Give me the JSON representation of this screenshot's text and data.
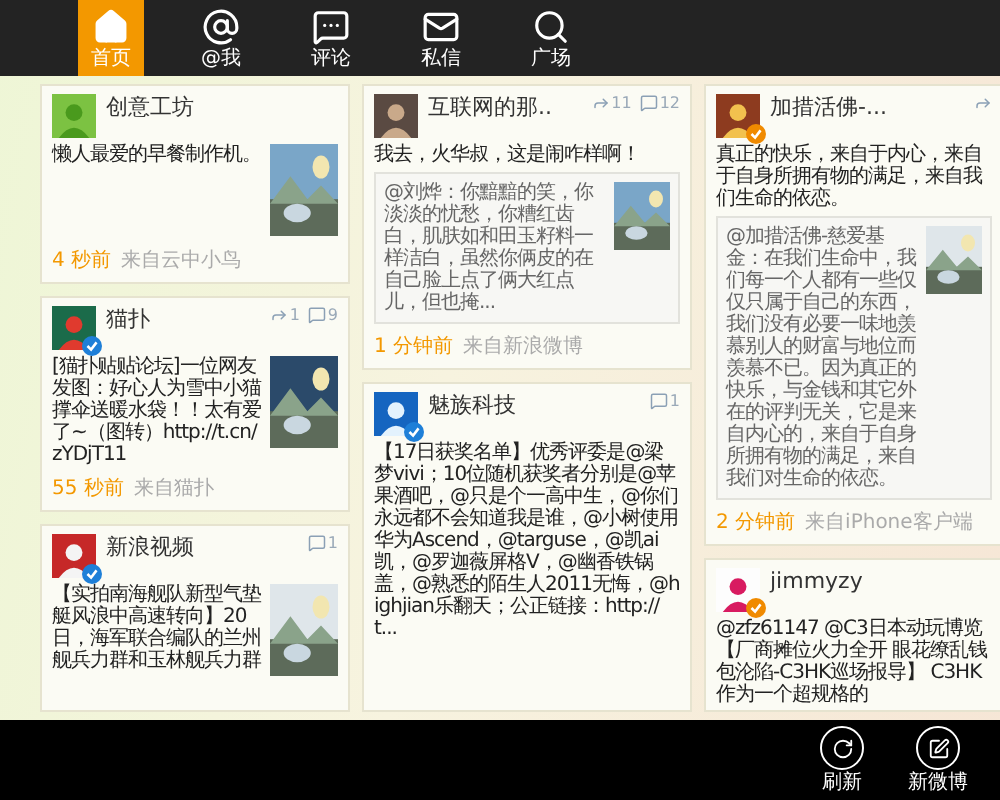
{
  "nav": {
    "tabs": [
      {
        "kind": "home",
        "label": "首页",
        "selected": true
      },
      {
        "kind": "at",
        "label": "@我",
        "selected": false
      },
      {
        "kind": "comment",
        "label": "评论",
        "selected": false
      },
      {
        "kind": "mail",
        "label": "私信",
        "selected": false
      },
      {
        "kind": "search",
        "label": "广场",
        "selected": false
      }
    ]
  },
  "columns": [
    {
      "posts": [
        {
          "name": "创意工坊",
          "verified": false,
          "text": "懒人最爱的早餐制作机。",
          "image": {
            "kind": "picture"
          },
          "time": "4 秒前",
          "source": "来自云中小鸟"
        },
        {
          "name": "猫扑",
          "verified": true,
          "color": "#1e7fd8",
          "counts": [
            {
              "kind": "repost",
              "count": "1"
            },
            {
              "kind": "comment",
              "count": "9"
            }
          ],
          "text": "[猫扑贴贴论坛]一位网友发图：好心人为雪中小猫撑伞送暖水袋！！太有爱了~（图转）http://t.cn/zYDjT11",
          "image": {
            "kind": "picture"
          },
          "time": "55 秒前",
          "source": "来自猫扑"
        },
        {
          "name": "新浪视频",
          "verified": true,
          "color": "#1e7fd8",
          "counts": [
            {
              "kind": "comment",
              "count": "1"
            }
          ],
          "text": "【实拍南海舰队新型气垫艇风浪中高速转向】20日，海军联合编队的兰州舰兵力群和玉林舰兵力群",
          "image": {
            "kind": "picture"
          }
        }
      ]
    },
    {
      "posts": [
        {
          "name": "互联网的那..",
          "verified": false,
          "counts": [
            {
              "kind": "repost",
              "count": "11"
            },
            {
              "kind": "comment",
              "count": "12"
            }
          ],
          "text": "我去，火华叔，这是闹咋样啊！",
          "quote": {
            "text": "@刘烨：你黯黯的笑，你淡淡的忧愁，你糟红齿白，肌肤如和田玉籽料一样洁白，虽然你俩皮的在自己脸上点了俩大红点儿，但也掩...",
            "image": {
              "kind": "picture"
            }
          },
          "time": "1 分钟前",
          "source": "来自新浪微博"
        },
        {
          "name": "魅族科技",
          "verified": true,
          "color": "#1e7fd8",
          "counts": [
            {
              "kind": "comment",
              "count": "1"
            }
          ],
          "text": "【17日获奖名单】优秀评委是@梁梦vivi；10位随机获奖者分别是@苹果酒吧，@只是个一高中生，@你们永远都不会知道我是谁，@小树使用华为Ascend，@targuse，@凯ai凯，@罗迦薇屏格V，@幽香铁锅盖，@熟悉的陌生人2011无悔，@highjian乐翻天；公正链接：http://t..."
        }
      ]
    },
    {
      "posts": [
        {
          "name": "加措活佛-...",
          "verified": true,
          "color": "#f08a00",
          "counts": [
            {
              "kind": "repost"
            }
          ],
          "text": "真正的快乐，来自于内心，来自于自身所拥有物的满足，来自我们生命的依恋。",
          "quote": {
            "text": "@加措活佛-慈爱基金：在我们生命中，我们每一个人都有一些仅仅只属于自己的东西，我们没有必要一味地羡慕别人的财富与地位而羡慕不已。因为真正的快乐，与金钱和其它外在的评判无关，它是来自内心的，来自于自身所拥有物的满足，来自我们对生命的依恋。",
            "image": {
              "kind": "picture"
            }
          },
          "time": "2 分钟前",
          "source": "来自iPhone客户端"
        },
        {
          "name": "jimmyzy",
          "verified": true,
          "color": "#f08a00",
          "text": "@zfz61147 @C3日本动玩博览【厂商摊位火力全开 眼花缭乱钱包沦陷-C3HK巡场报导】 C3HK作为一个超规格的"
        }
      ]
    }
  ],
  "app_bar": {
    "buttons": [
      {
        "kind": "refresh",
        "label": "刷新"
      },
      {
        "kind": "compose",
        "label": "新微博"
      }
    ]
  }
}
